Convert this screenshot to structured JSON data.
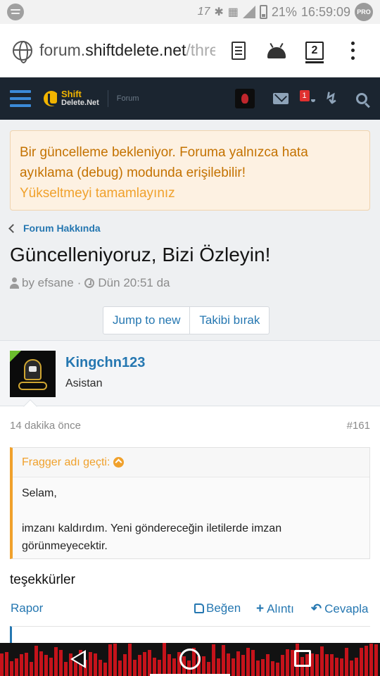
{
  "statusbar": {
    "notif_count": "17",
    "battery": "21%",
    "time": "16:59:09",
    "pro_badge": "PRO"
  },
  "browser": {
    "url_domain": "forum.",
    "url_host": "shiftdelete.net",
    "url_path": "/thre",
    "tab_count": "2"
  },
  "forum_header": {
    "logo_line1": "Shift",
    "logo_line2": "Delete.Net",
    "section_label": "Forum",
    "alerts_badge": "1"
  },
  "notice": {
    "message": "Bir güncelleme bekleniyor. Foruma yalnızca hata ayıklama (debug) modunda erişilebilir!",
    "link": "Yükseltmeyi tamamlayınız"
  },
  "breadcrumb": {
    "label": "Forum Hakkında"
  },
  "thread": {
    "title": "Güncelleniyoruz, Bizi Özleyin!",
    "author": "by efsane",
    "time": "Dün 20:51 da",
    "separator": "·",
    "buttons": {
      "jump": "Jump to new",
      "unwatch": "Takibi bırak"
    }
  },
  "post": {
    "username": "Kingchn123",
    "role": "Asistan",
    "time": "14 dakika önce",
    "number": "#161",
    "quote": {
      "attribution": "Fragger adı geçti:",
      "line1": "Selam,",
      "line2": "imzanı kaldırdım. Yeni göndereceğin iletilerde imzan görünmeyecektir."
    },
    "text": "teşekkürler",
    "actions": {
      "report": "Rapor",
      "like": "Beğen",
      "quote": "Alıntı",
      "reply": "Cevapla"
    }
  },
  "colors": {
    "forum_header_bg": "#1b2530",
    "link_blue": "#2577b1",
    "notice_text": "#c47200",
    "notice_link": "#f0a12c",
    "quote_accent": "#f0a12c",
    "nav_visualizer_red": "#c6131b"
  }
}
